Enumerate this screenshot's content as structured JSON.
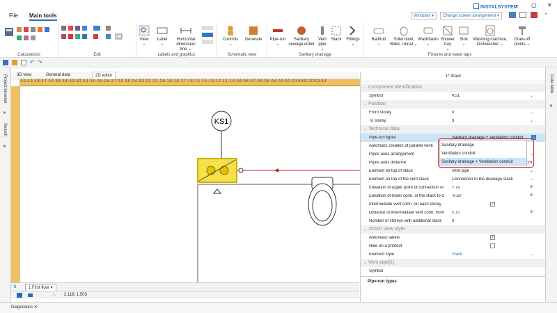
{
  "app": {
    "brand": "INSTALSYSTEM"
  },
  "menu": {
    "file": "File",
    "main_tools": "Main tools"
  },
  "top_right": {
    "windows": "Windows",
    "arrangement": "Change screen arrangement"
  },
  "ribbon": {
    "groups": {
      "calculations": "Calculations",
      "edit": "Edit",
      "labels": "Labels and graphics",
      "schematic": "Schematic view",
      "sanitary": "Sanitary drainage",
      "fixtures": "Fixtures and water taps"
    },
    "view": "View",
    "label": "Label",
    "horiz_dim": "Horizontal dimension line",
    "controls": "Controls",
    "generate": "Generate",
    "pipe_run": "Pipe-run",
    "sanitary_outlet": "Sanitary sewage outlet",
    "vent_pipe": "Vent pipe",
    "stack": "Stack",
    "fittings": "Fittings",
    "bathtub": "Bathtub",
    "toilet": "Toilet bowl, Bidet, Urinal",
    "washbasin": "Washbasin",
    "shower": "Shower tray",
    "sink": "Sink",
    "washing": "Washing machine, Dishwasher",
    "drawoff": "Draw-off points"
  },
  "sidebar": {
    "project_browser": "Project browser",
    "search": "Search"
  },
  "doc_tabs": {
    "view3d": "3D view",
    "general": "General data",
    "editor2d": "2D editor"
  },
  "ruler_labels": [
    "-4.0",
    "-3.9",
    "-3.8",
    "-3.7",
    "-3.6",
    "-3.5",
    "-3.4",
    "-3.3",
    "-3.2",
    "-3.1",
    "-3.0",
    "-2.9",
    "-2.8",
    "-2.7",
    "-2.6",
    "-2.5",
    "-2.4",
    "-2.3",
    "-2.2",
    "-2.1",
    "-2.0",
    "-1.9",
    "-1.8",
    "-1.7",
    "-1.6",
    "-1.5",
    "-1.4",
    "-1.3",
    "-1.2",
    "-1.1",
    "-1.0",
    "-0.9",
    "-0.8",
    "-0.7",
    "-0.6",
    "-0.5",
    "-0.4",
    "-0.3",
    "-0.2",
    "-0.1",
    "0.0",
    "0.1",
    "0.2",
    "0.3",
    "0.4"
  ],
  "canvas": {
    "stack_label": "KS1"
  },
  "floor": {
    "name": "1 First floor"
  },
  "status": {
    "coords": "2.118, 1.503"
  },
  "diagnostics": {
    "label": "Diagnostics"
  },
  "right_bar": {
    "data_table": "Data table"
  },
  "panel": {
    "title": "1* Stack",
    "sections": {
      "component": "Component identification",
      "position": "Position",
      "technical": "Technical data",
      "view_style": "2D/3D view style",
      "vent_pipe": "Vent pipe[1]"
    },
    "rows": [
      {
        "k": "Symbol",
        "v": "KS1"
      },
      {
        "k": "From storey",
        "v": "0"
      },
      {
        "k": "To storey",
        "v": "3"
      },
      {
        "k": "Pipe-run types",
        "v": "Sanitary drainage + Ventilation conduit"
      },
      {
        "k": "Automatic creation of parallel venti",
        "v": ""
      },
      {
        "k": "Pipes axes arrangement",
        "v": ""
      },
      {
        "k": "Pipes axes distance",
        "v": "cm"
      },
      {
        "k": "Element on top of stack",
        "v": "Vent pipe"
      },
      {
        "k": "Element on top of the vent stack",
        "v": "Connection to the drainage stack"
      },
      {
        "k": "Elevation of upper point of connection of",
        "v": "7.70"
      },
      {
        "k": "Elevation of lower conn. of the stack to d",
        "v": "-0.50"
      },
      {
        "k": "Intermediate vent conn. on each storey",
        "v": ""
      },
      {
        "k": "Distance of intermediate vent conn. from",
        "v": "0.10"
      },
      {
        "k": "Number of storeys with additional stack",
        "v": "0"
      },
      {
        "k": "Automatic labels",
        "v": ""
      },
      {
        "k": "Hide on a printout",
        "v": ""
      },
      {
        "k": "Element style",
        "v": "Stack"
      },
      {
        "k": "Symbol",
        "v": ""
      }
    ],
    "units": {
      "m": "m"
    },
    "description": "Pipe-run types"
  },
  "popup": {
    "items": [
      "Sanitary drainage",
      "Ventilation conduit",
      "Sanitary drainage + Ventilation conduit"
    ]
  },
  "colors": {
    "accent": "#1f6fbf",
    "selection": "#f0d000",
    "pipe": "#c0202a",
    "highlight": "#d0302b"
  }
}
